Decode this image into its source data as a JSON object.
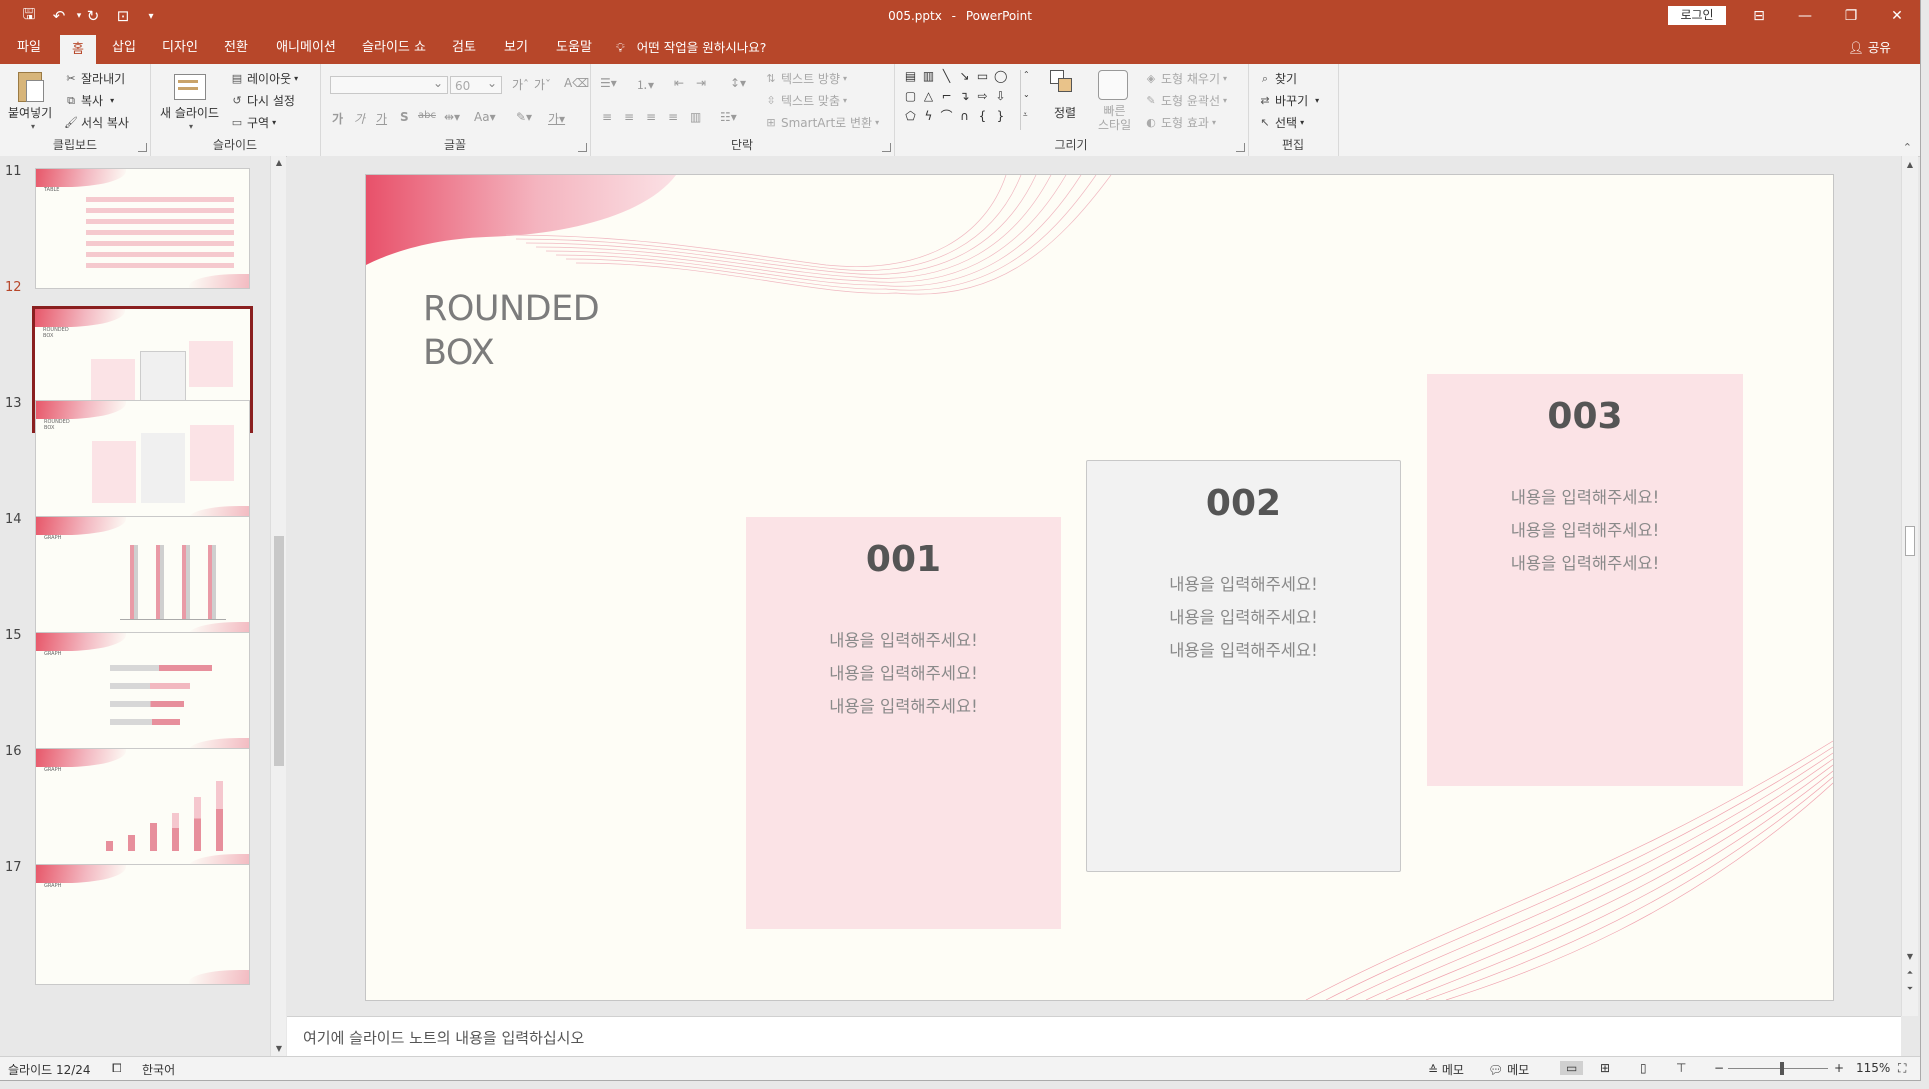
{
  "app": {
    "file_name": "005.pptx",
    "app_name": "PowerPoint",
    "separator": "-",
    "login": "로그인"
  },
  "tabs": [
    "파일",
    "홈",
    "삽입",
    "디자인",
    "전환",
    "애니메이션",
    "슬라이드 쇼",
    "검토",
    "보기",
    "도움말"
  ],
  "active_tab": "홈",
  "tell_me": "어떤 작업을 원하시나요?",
  "share": "공유",
  "ribbon": {
    "clipboard": {
      "label": "클립보드",
      "paste": "붙여넣기",
      "cut": "잘라내기",
      "copy": "복사",
      "format_painter": "서식 복사"
    },
    "slides": {
      "label": "슬라이드",
      "new_slide": "새 슬라이드",
      "layout": "레이아웃",
      "reset": "다시 설정",
      "section": "구역"
    },
    "font": {
      "label": "글꼴",
      "font_name": "",
      "font_size": "60"
    },
    "paragraph": {
      "label": "단락",
      "text_direction": "텍스트 방향",
      "align_text": "텍스트 맞춤",
      "smartart": "SmartArt로 변환"
    },
    "drawing": {
      "label": "그리기",
      "arrange": "정렬",
      "quick_styles": "빠른\n스타일",
      "fill": "도형 채우기",
      "outline": "도형 윤곽선",
      "effects": "도형 효과"
    },
    "editing": {
      "label": "편집",
      "find": "찾기",
      "replace": "바꾸기",
      "select": "선택"
    }
  },
  "thumbnails": [
    {
      "num": "11",
      "caption": "TABLE"
    },
    {
      "num": "12",
      "caption": "ROUNDED\nBOX",
      "selected": true
    },
    {
      "num": "13",
      "caption": "ROUNDED\nBOX"
    },
    {
      "num": "14",
      "caption": "GRAPH"
    },
    {
      "num": "15",
      "caption": "GRAPH"
    },
    {
      "num": "16",
      "caption": "GRAPH"
    },
    {
      "num": "17",
      "caption": "GRAPH"
    }
  ],
  "slide": {
    "title_line1": "ROUNDED",
    "title_line2": "BOX",
    "cards": [
      {
        "num": "001",
        "lines": [
          "내용을 입력해주세요!",
          "내용을 입력해주세요!",
          "내용을 입력해주세요!"
        ],
        "color": "#fbe3e6"
      },
      {
        "num": "002",
        "lines": [
          "내용을 입력해주세요!",
          "내용을 입력해주세요!",
          "내용을 입력해주세요!"
        ],
        "color": "#f2f2f2"
      },
      {
        "num": "003",
        "lines": [
          "내용을 입력해주세요!",
          "내용을 입력해주세요!",
          "내용을 입력해주세요!"
        ],
        "color": "#fbe3e6"
      }
    ]
  },
  "notes_placeholder": "여기에 슬라이드 노트의 내용을 입력하십시오",
  "status": {
    "slide_counter": "슬라이드 12/24",
    "language": "한국어",
    "notes": "메모",
    "comments": "메모",
    "zoom": "115%"
  },
  "colors": {
    "accent": "#b7472a",
    "card_pink": "#fbe3e6",
    "card_gray": "#f2f2f2",
    "slide_bg": "#fefdf6"
  }
}
